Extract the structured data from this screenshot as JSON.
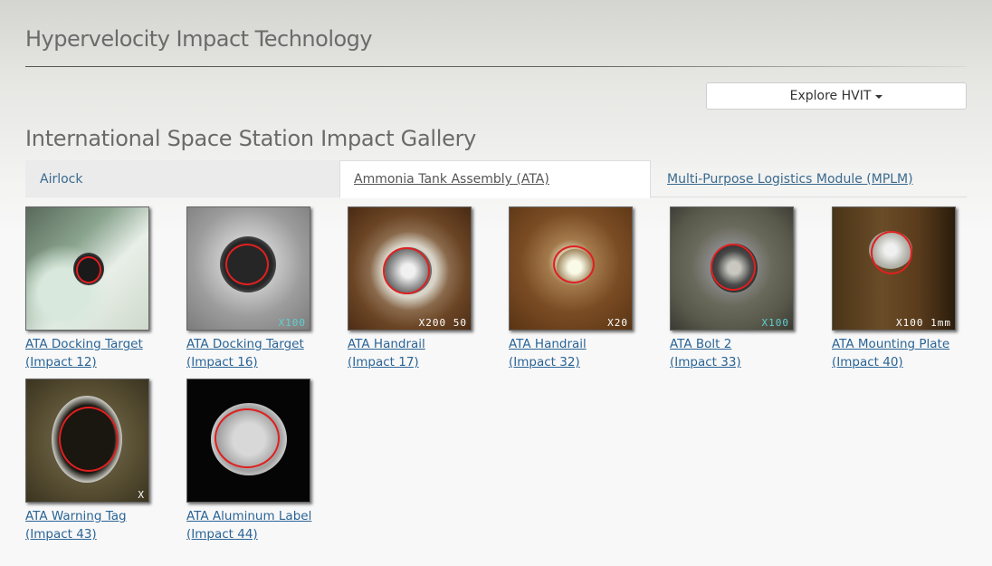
{
  "site": {
    "title": "Hypervelocity Impact Technology"
  },
  "nav": {
    "explore_label": "Explore HVIT"
  },
  "page": {
    "title": "International Space Station Impact Gallery"
  },
  "tabs": [
    {
      "label": "Airlock"
    },
    {
      "label": "Ammonia Tank Assembly (ATA)"
    },
    {
      "label": "Multi-Purpose Logistics Module (MPLM)"
    }
  ],
  "gallery": [
    {
      "name": "ATA Docking Target ",
      "impact": "(Impact 12)",
      "scale": ""
    },
    {
      "name": "ATA Docking Target ",
      "impact": "(Impact 16)",
      "scale": "X100"
    },
    {
      "name": "ATA Handrail ",
      "impact": "(Impact 17)",
      "scale": "X200 50"
    },
    {
      "name": "ATA Handrail ",
      "impact": "(Impact 32)",
      "scale": "X20"
    },
    {
      "name": "ATA Bolt 2 ",
      "impact": "(Impact 33)",
      "scale": "X100"
    },
    {
      "name": "ATA Mounting Plate ",
      "impact": "(Impact 40)",
      "scale": "X100 1mm"
    },
    {
      "name": "ATA Warning Tag ",
      "impact": "(Impact 43)",
      "scale": "X"
    },
    {
      "name": "ATA Aluminum Label ",
      "impact": "(Impact 44)",
      "scale": ""
    }
  ]
}
